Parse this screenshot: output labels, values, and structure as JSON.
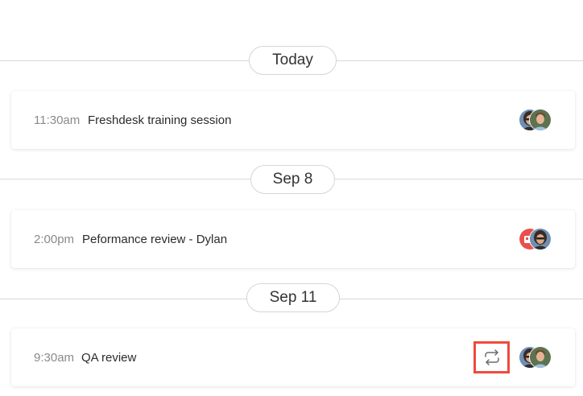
{
  "groups": [
    {
      "date_label": "Today",
      "event": {
        "time": "11:30am",
        "title": "Freshdesk training session",
        "attendees": [
          "attendee-photo-woman",
          "attendee-photo-man"
        ],
        "recurring": false
      }
    },
    {
      "date_label": "Sep 8",
      "event": {
        "time": "2:00pm",
        "title": "Peformance review - Dylan",
        "attendees": [
          "attendee-app-icon-red",
          "attendee-photo-woman"
        ],
        "recurring": false
      }
    },
    {
      "date_label": "Sep 11",
      "event": {
        "time": "9:30am",
        "title": "QA review",
        "attendees": [
          "attendee-photo-woman",
          "attendee-photo-man"
        ],
        "recurring": true,
        "recurring_icon": "repeat-icon"
      }
    }
  ],
  "colors": {
    "highlight": "#f04a3e",
    "app_icon_red": "#e8504a",
    "divider": "#d9d9d9"
  }
}
